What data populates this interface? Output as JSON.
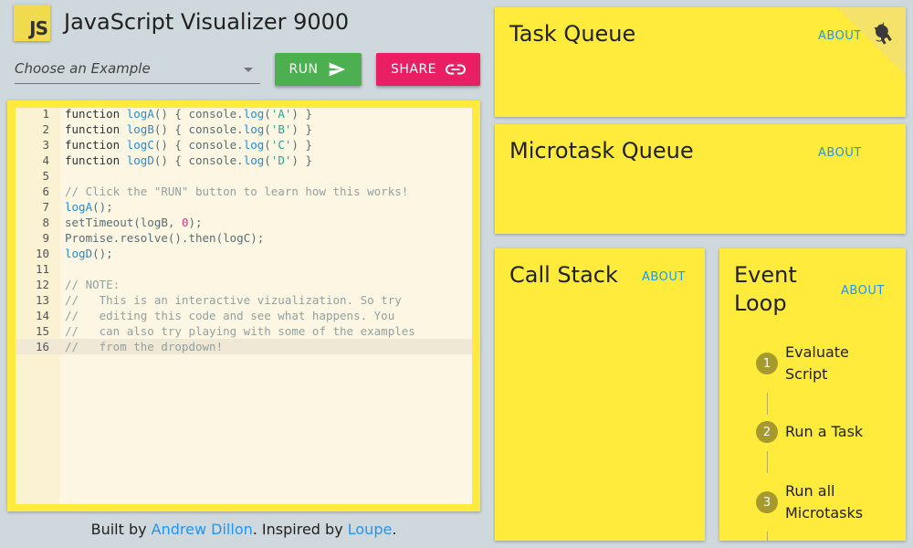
{
  "header": {
    "logo_text": "JS",
    "title": "JavaScript Visualizer 9000"
  },
  "toolbar": {
    "example_select": "Choose an Example",
    "run_label": "RUN",
    "share_label": "SHARE"
  },
  "editor": {
    "active_line": 16,
    "lines": [
      {
        "n": "1",
        "text": "function logA() { console.log('A') }"
      },
      {
        "n": "2",
        "text": "function logB() { console.log('B') }"
      },
      {
        "n": "3",
        "text": "function logC() { console.log('C') }"
      },
      {
        "n": "4",
        "text": "function logD() { console.log('D') }"
      },
      {
        "n": "5",
        "text": ""
      },
      {
        "n": "6",
        "text": "// Click the \"RUN\" button to learn how this works!"
      },
      {
        "n": "7",
        "text": "logA();"
      },
      {
        "n": "8",
        "text": "setTimeout(logB, 0);"
      },
      {
        "n": "9",
        "text": "Promise.resolve().then(logC);"
      },
      {
        "n": "10",
        "text": "logD();"
      },
      {
        "n": "11",
        "text": ""
      },
      {
        "n": "12",
        "text": "// NOTE:"
      },
      {
        "n": "13",
        "text": "//   This is an interactive vizualization. So try"
      },
      {
        "n": "14",
        "text": "//   editing this code and see what happens. You"
      },
      {
        "n": "15",
        "text": "//   can also try playing with some of the examples"
      },
      {
        "n": "16",
        "text": "//   from the dropdown!"
      }
    ]
  },
  "footer": {
    "built_by": "Built by ",
    "author": "Andrew Dillon",
    "inspired": ". Inspired by ",
    "inspiration": "Loupe",
    "end": "."
  },
  "panels": {
    "task_queue": {
      "title": "Task Queue",
      "about": "ABOUT"
    },
    "microtask_queue": {
      "title": "Microtask Queue",
      "about": "ABOUT"
    },
    "call_stack": {
      "title": "Call Stack",
      "about": "ABOUT"
    },
    "event_loop": {
      "title_line1": "Event",
      "title_line2": "Loop",
      "about": "ABOUT",
      "steps": [
        {
          "num": "1",
          "label": "Evaluate Script"
        },
        {
          "num": "2",
          "label": "Run a Task"
        },
        {
          "num": "3",
          "label": "Run all Microtasks"
        }
      ]
    }
  },
  "icons": {
    "corner": "github-icon",
    "run": "send-icon",
    "share": "link-icon"
  },
  "colors": {
    "panel_yellow": "#ffeb3b",
    "run_green": "#4caf50",
    "share_pink": "#e91e63",
    "link_blue": "#2196f3",
    "step_circle": "#a69a2e"
  }
}
